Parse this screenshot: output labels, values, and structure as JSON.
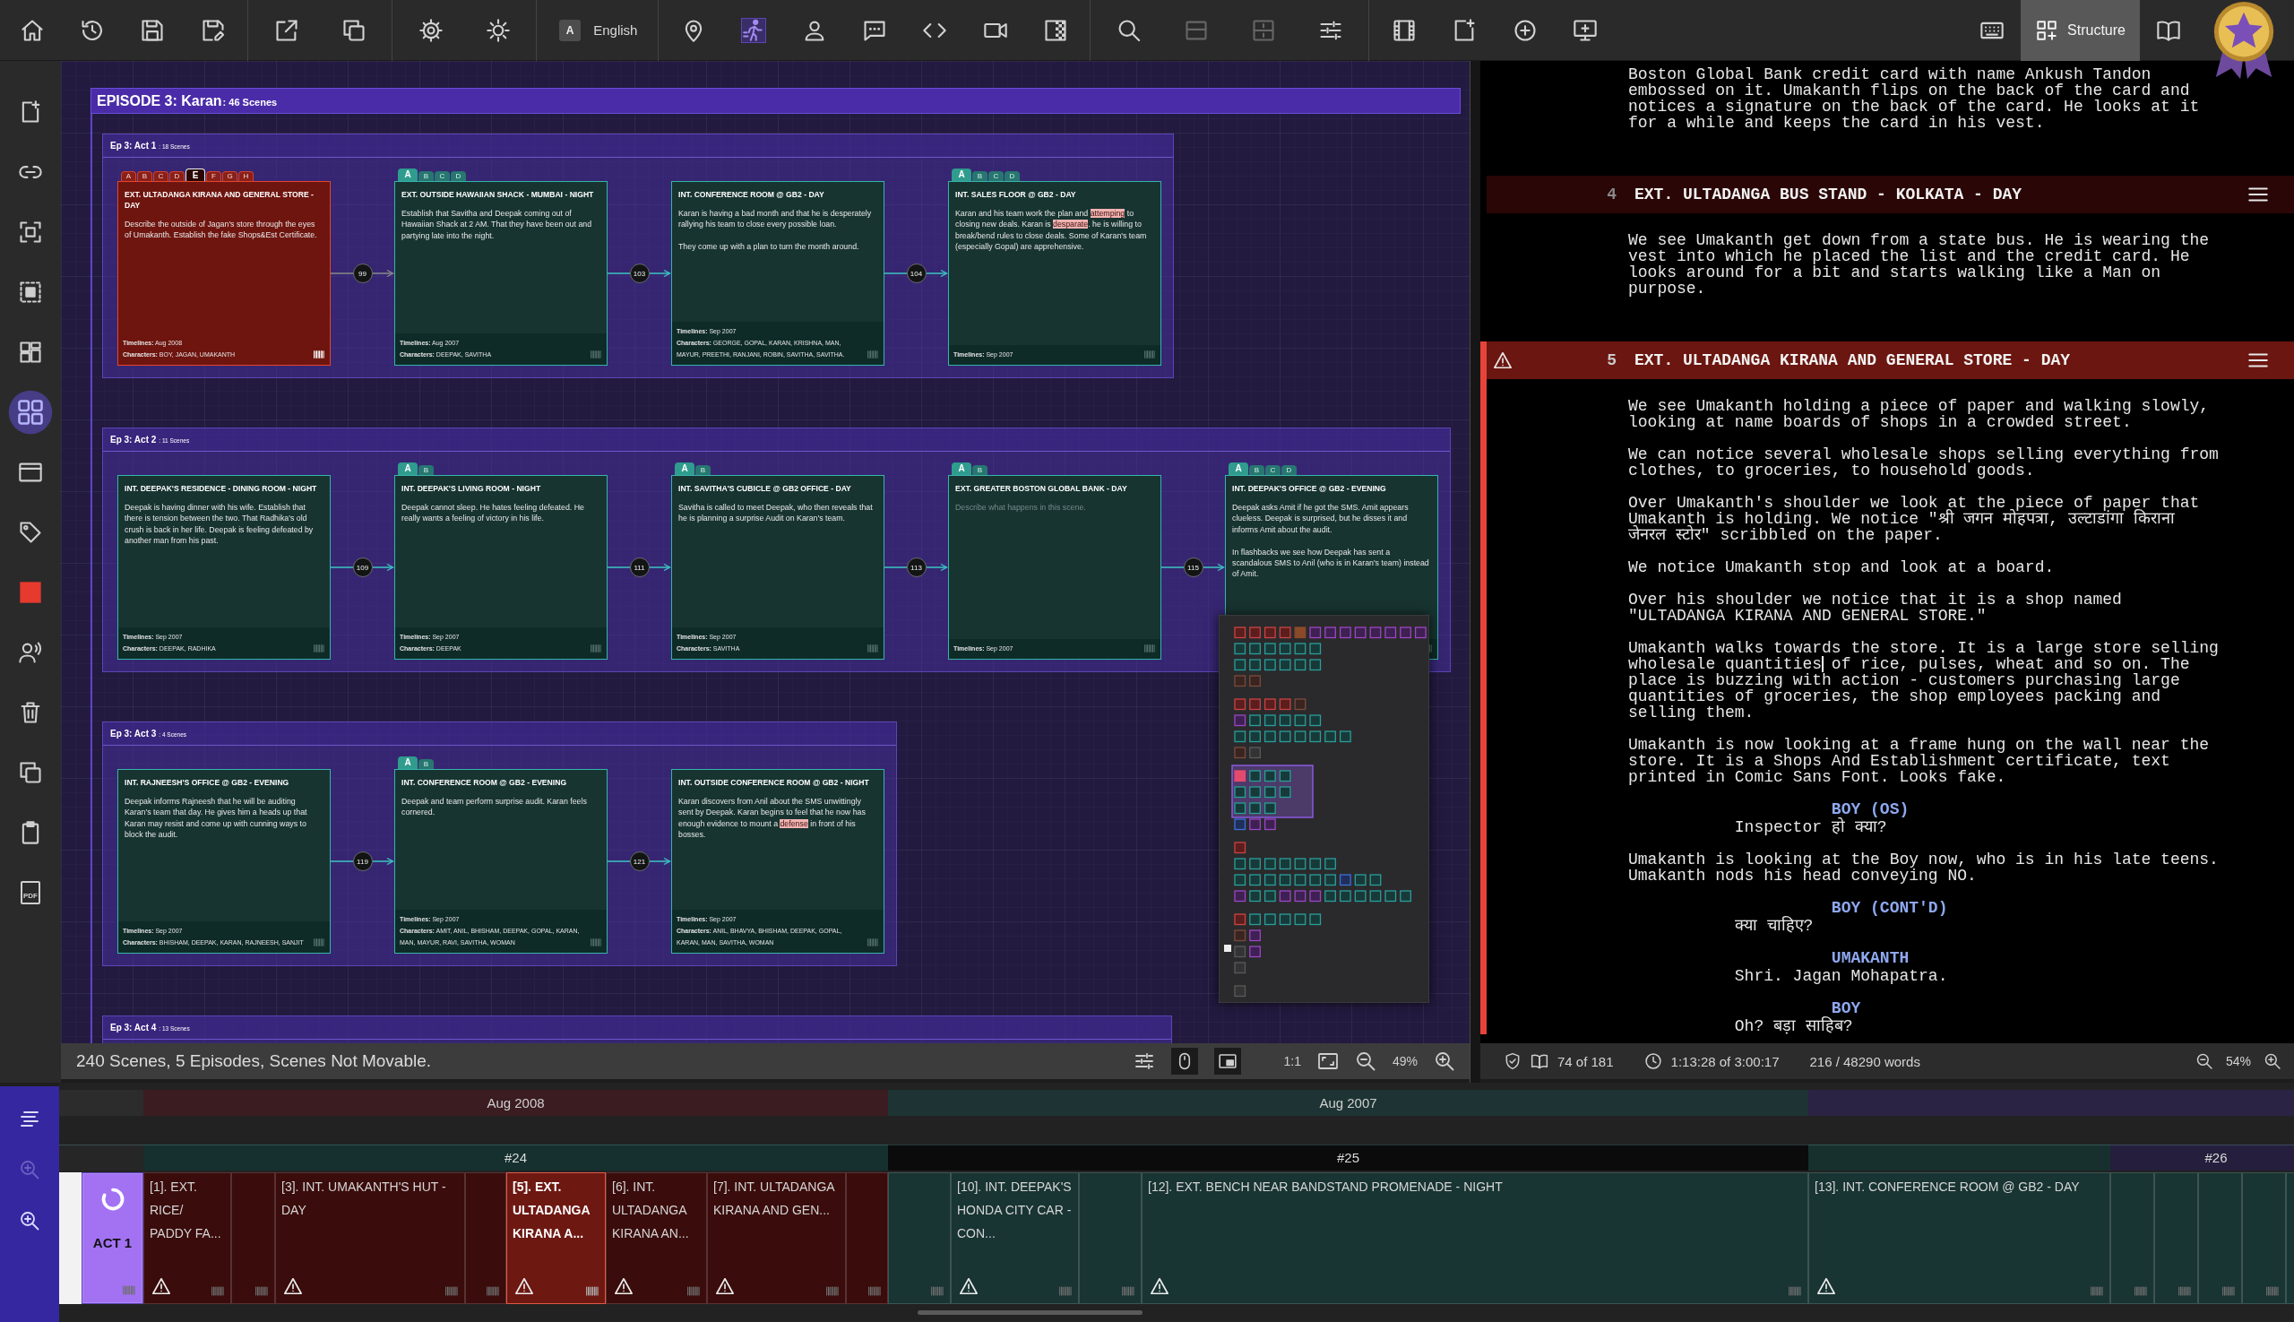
{
  "toolbar": {
    "tools": [
      {
        "active": false,
        "disabled": false
      },
      {
        "active": false,
        "disabled": false
      },
      {
        "active": false,
        "disabled": false
      },
      {
        "active": false,
        "disabled": false
      },
      {
        "active": false,
        "disabled": false
      },
      {
        "active": false,
        "disabled": false
      },
      {
        "active": false,
        "disabled": false
      },
      {
        "active": false,
        "disabled": false
      },
      {
        "active": false,
        "disabled": false
      },
      {
        "active": true,
        "disabled": false
      },
      {
        "active": false,
        "disabled": false
      },
      {
        "active": false,
        "disabled": false
      },
      {
        "active": false,
        "disabled": false
      },
      {
        "active": false,
        "disabled": false
      },
      {
        "active": false,
        "disabled": false
      },
      {
        "active": false,
        "disabled": false
      },
      {
        "active": false,
        "disabled": true
      },
      {
        "active": false,
        "disabled": true
      },
      {
        "active": false,
        "disabled": false
      },
      {
        "active": false,
        "disabled": false
      },
      {
        "active": false,
        "disabled": false
      },
      {
        "active": false,
        "disabled": false
      },
      {
        "active": false,
        "disabled": false
      },
      {
        "active": false,
        "disabled": false
      },
      {
        "active": false,
        "disabled": false
      }
    ],
    "language": {
      "badge": "A",
      "label": "English"
    },
    "structure_button": {
      "label": "Structure",
      "selected": true
    }
  },
  "sidebar": {
    "items": [
      {
        "selected": false
      },
      {
        "selected": false
      },
      {
        "selected": false
      },
      {
        "selected": false
      },
      {
        "selected": false
      },
      {
        "selected": true
      },
      {
        "selected": false
      },
      {
        "selected": false
      },
      {
        "selected": false
      },
      {
        "selected": false
      },
      {
        "selected": false
      },
      {
        "selected": false
      },
      {
        "selected": false
      },
      {
        "selected": false,
        "label": "PDF"
      }
    ]
  },
  "episode": {
    "title": "EPISODE 3: Karan",
    "scene_count": ": 46 Scenes",
    "acts": [
      {
        "title": "Ep 3: Act 1",
        "scene_count": ": 18 Scenes",
        "connectors": [
          "99",
          "103",
          "104"
        ],
        "cards": [
          {
            "selected": true,
            "tabs": [
              {
                "label": "A",
                "selected": false
              },
              {
                "label": "B",
                "selected": false
              },
              {
                "label": "C",
                "selected": false
              },
              {
                "label": "D",
                "selected": false
              },
              {
                "label": "E",
                "selected": true
              },
              {
                "label": "F",
                "selected": false
              },
              {
                "label": "G",
                "selected": false
              },
              {
                "label": "H",
                "selected": false
              }
            ],
            "title": "EXT. ULTADANGA KIRANA AND GENERAL STORE - DAY",
            "paragraphs": [
              [
                {
                  "text": "Describe the outside of Jagan's store through the eyes of Umakanth. Establish the fake Shops&Est Certificate.",
                  "flagged": false
                }
              ]
            ],
            "timelines": "**Timelines:** Aug 2008",
            "characters": "**Characters:** BOY, JAGAN, UMAKANTH"
          },
          {
            "selected": false,
            "tabs": [
              {
                "label": "A",
                "selected": true
              },
              {
                "label": "B",
                "selected": false
              },
              {
                "label": "C",
                "selected": false
              },
              {
                "label": "D",
                "selected": false
              }
            ],
            "title": "EXT. OUTSIDE HAWAIIAN SHACK - MUMBAI - NIGHT",
            "paragraphs": [
              [
                {
                  "text": "Establish that Savitha and Deepak coming out of Hawaiian Shack at 2 AM. That they have been out and partying late into the night.",
                  "flagged": false
                }
              ]
            ],
            "timelines": "**Timelines:** Aug 2007",
            "characters": "**Characters:** DEEPAK, SAVITHA"
          },
          {
            "selected": false,
            "title": "INT. CONFERENCE ROOM @ GB2 - DAY",
            "paragraphs": [
              [
                {
                  "text": "Karan is having a bad month and that he is desperately rallying his team to close every possible loan.",
                  "flagged": false
                }
              ],
              [
                {
                  "text": "They come up with a plan to turn the month around.",
                  "flagged": false
                }
              ]
            ],
            "timelines": "**Timelines:** Sep 2007",
            "characters": "**Characters:** GEORGE, GOPAL, KARAN, KRISHNA, MAN, MAYUR, PREETHI, RANJANI, ROBIN, SAVITHA, SAVITHA."
          },
          {
            "selected": false,
            "tabs": [
              {
                "label": "A",
                "selected": true
              },
              {
                "label": "B",
                "selected": false
              },
              {
                "label": "C",
                "selected": false
              },
              {
                "label": "D",
                "selected": false
              }
            ],
            "title": "INT. SALES FLOOR @ GB2 - DAY",
            "paragraphs": [
              [
                {
                  "text": "Karan and his team work the plan and ",
                  "flagged": false
                },
                {
                  "text": "attemping",
                  "flagged": true
                },
                {
                  "text": " to closing new deals. Karan is ",
                  "flagged": false
                },
                {
                  "text": "desparate",
                  "flagged": true
                },
                {
                  "text": ". he is willing to break/bend rules to close deals. Some of Karan's team (especially Gopal) are apprehensive.",
                  "flagged": false
                }
              ]
            ],
            "timelines": "**Timelines:** Sep 2007"
          }
        ]
      },
      {
        "title": "Ep 3: Act 2",
        "scene_count": ": 11 Scenes",
        "connectors": [
          "109",
          "111",
          "113",
          "115"
        ],
        "cards": [
          {
            "selected": false,
            "title": "INT. DEEPAK'S RESIDENCE - DINING ROOM - NIGHT",
            "paragraphs": [
              [
                {
                  "text": "Deepak is having dinner with his wife. Establish that there is tension between the two. That Radhika's old crush is back in her life. Deepak is feeling defeated by another man from his past.",
                  "flagged": false
                }
              ]
            ],
            "timelines": "**Timelines:** Sep 2007",
            "characters": "**Characters:** DEEPAK, RADHIKA"
          },
          {
            "selected": false,
            "tabs": [
              {
                "label": "A",
                "selected": true
              },
              {
                "label": "B",
                "selected": false
              }
            ],
            "title": "INT. DEEPAK'S LIVING ROOM - NIGHT",
            "paragraphs": [
              [
                {
                  "text": "Deepak cannot sleep. He hates feeling defeated. He really wants a feeling of victory in his life.",
                  "flagged": false
                }
              ]
            ],
            "timelines": "**Timelines:** Sep 2007",
            "characters": "**Characters:** DEEPAK"
          },
          {
            "selected": false,
            "tabs": [
              {
                "label": "A",
                "selected": true
              },
              {
                "label": "B",
                "selected": false
              }
            ],
            "title": "INT. SAVITHA'S CUBICLE @ GB2 OFFICE - DAY",
            "paragraphs": [
              [
                {
                  "text": "Savitha is called to meet Deepak, who then reveals that he is planning a surprise Audit on Karan's team.",
                  "flagged": false
                }
              ]
            ],
            "timelines": "**Timelines:** Sep 2007",
            "characters": "**Characters:** SAVITHA"
          },
          {
            "selected": false,
            "tabs": [
              {
                "label": "A",
                "selected": true
              },
              {
                "label": "B",
                "selected": false
              }
            ],
            "title": "EXT. GREATER BOSTON GLOBAL BANK - DAY",
            "placeholder": "Describe what happens in this scene.",
            "timelines": "**Timelines:** Sep 2007"
          },
          {
            "selected": false,
            "tabs": [
              {
                "label": "A",
                "selected": true
              },
              {
                "label": "B",
                "selected": false
              },
              {
                "label": "C",
                "selected": false
              },
              {
                "label": "D",
                "selected": false
              }
            ],
            "title": "INT. DEEPAK'S OFFICE @ GB2 - EVENING",
            "paragraphs": [
              [
                {
                  "text": "Deepak asks Amit if he got the SMS. Amit appears clueless. Deepak is surprised, but he disses it and informs Amit about the audit.",
                  "flagged": false
                }
              ],
              [
                {
                  "text": "In flashbacks we see how Deepak has sent a scandalous SMS to Anil (who is in Karan's team) instead of Amit.",
                  "flagged": false
                }
              ]
            ]
          }
        ]
      },
      {
        "title": "Ep 3: Act 3",
        "scene_count": ": 4 Scenes",
        "connectors": [
          "119",
          "121"
        ],
        "cards": [
          {
            "selected": false,
            "title": "INT. RAJNEESH'S OFFICE @ GB2 - EVENING",
            "paragraphs": [
              [
                {
                  "text": "Deepak informs Rajneesh that he will be auditing Karan's team that day. He gives him a heads up that Karan may resist and come up with cunning ways to block the audit.",
                  "flagged": false
                }
              ]
            ],
            "timelines": "**Timelines:** Sep 2007",
            "characters": "**Characters:** BHISHAM, DEEPAK, KARAN, RAJNEESH, SANJIT"
          },
          {
            "selected": false,
            "tabs": [
              {
                "label": "A",
                "selected": true
              },
              {
                "label": "B",
                "selected": false
              }
            ],
            "title": "INT. CONFERENCE ROOM @ GB2 - EVENING",
            "paragraphs": [
              [
                {
                  "text": "Deepak and team perform surprise audit. Karan feels cornered.",
                  "flagged": false
                }
              ]
            ],
            "timelines": "**Timelines:** Sep 2007",
            "characters": "**Characters:** AMIT, ANIL, BHISHAM, DEEPAK, GOPAL, KARAN, MAN, MAYUR, RAVI, SAVITHA, WOMAN"
          },
          {
            "selected": false,
            "title": "INT. OUTSIDE CONFERENCE ROOM @ GB2 - NIGHT",
            "paragraphs": [
              [
                {
                  "text": "Karan discovers from Anil about the SMS unwittingly sent by Deepak. Karan begins to feel that he now has enough evidence to mount a ",
                  "flagged": false
                },
                {
                  "text": "defense",
                  "flagged": true
                },
                {
                  "text": " in front of his bosses.",
                  "flagged": false
                }
              ]
            ],
            "timelines": "**Timelines:** Sep 2007",
            "characters": "**Characters:** ANIL, BHAVYA, BHISHAM, DEEPAK, GOPAL, KARAN, MAN, SAVITHA, WOMAN"
          }
        ]
      },
      {
        "title": "Ep 3: Act 4",
        "scene_count": ": 13 Scenes"
      }
    ]
  },
  "structure_status": {
    "text": "240 Scenes, 5 Episodes, Scenes Not Movable.",
    "toggles": [
      {
        "on": false
      },
      {
        "on": true
      },
      {
        "on": true
      }
    ],
    "actual_size": "1:1",
    "zoom": "49%"
  },
  "script": {
    "scenes": [
      {
        "selected": false,
        "blocks": [
          {
            "kind": "action",
            "text": "Boston Global Bank credit card with name Ankush Tandon embossed on it. Umakanth flips on the back of the card and notices a signature on the back of the card. He looks at it for a while and keeps the card in his vest."
          }
        ]
      },
      {
        "selected": false,
        "heading": {
          "number": "4",
          "text": "EXT. ULTADANGA BUS STAND - KOLKATA - DAY",
          "warning": false
        },
        "blocks": [
          {
            "kind": "action",
            "text": "We see Umakanth get down from a state bus. He is wearing the vest into which he placed the list and the credit card. He looks around for a bit and starts walking like a Man on purpose."
          }
        ]
      },
      {
        "selected": true,
        "heading": {
          "number": "5",
          "text": "EXT. ULTADANGA KIRANA AND GENERAL STORE - DAY",
          "warning": true
        },
        "blocks": [
          {
            "kind": "action",
            "text": "We see Umakanth holding a piece of paper and walking slowly, looking at name boards of shops in a crowded street."
          },
          {
            "kind": "action",
            "text": "We can notice several wholesale shops selling everything from clothes, to groceries, to household goods."
          },
          {
            "kind": "action",
            "text": "Over Umakanth's shoulder we look at the piece of paper that Umakanth is holding. We notice \"श्री जगन मोहपत्रा, उल्टाडांगा किराना जेनरल स्टोर\" scribbled on the paper."
          },
          {
            "kind": "action",
            "text": "We notice Umakanth stop and look at a board."
          },
          {
            "kind": "action",
            "text": "Over his shoulder we notice that it is a shop named \"ULTADANGA KIRANA AND GENERAL STORE.\""
          },
          {
            "kind": "action",
            "runs": [
              {
                "text": "Umakanth walks towards the store. It is a large store selling wholesale quantities",
                "cursor": true
              },
              {
                "text": " of rice, pulses, wheat and so on. The place is buzzing with action - customers purchasing large quantities of groceries, the shop employees packing and selling them.",
                "cursor": false
              }
            ]
          },
          {
            "kind": "action",
            "text": "Umakanth is now looking at a frame hung on the wall near the store. It is a Shops And Establishment certificate, text printed in Comic Sans Font. Looks fake."
          },
          {
            "kind": "character",
            "text": "BOY (OS)"
          },
          {
            "kind": "dialogue",
            "text": "Inspector हो क्या?"
          },
          {
            "kind": "action",
            "text": "Umakanth is looking at the Boy now, who is in his late teens. Umakanth nods his head conveying NO."
          },
          {
            "kind": "character",
            "text": "BOY (CONT'D)"
          },
          {
            "kind": "dialogue",
            "text": "क्या चाहिए?"
          },
          {
            "kind": "character",
            "text": "UMAKANTH"
          },
          {
            "kind": "dialogue",
            "text": "Shri. Jagan Mohapatra."
          },
          {
            "kind": "character",
            "text": "BOY"
          },
          {
            "kind": "dialogue",
            "text": "Oh? बड़ा साहिब?"
          }
        ]
      }
    ]
  },
  "script_status": {
    "page": "74 of 181",
    "time": "1:13:28 of 3:00:17",
    "words": "216 / 48290 words",
    "zoom": "54%"
  },
  "timeline": {
    "tools": [
      {
        "disabled": false
      },
      {
        "disabled": true
      },
      {
        "disabled": false
      }
    ],
    "groups": [
      {
        "color": "#2c2c2c",
        "sequences": [
          {
            "color": "#262626",
            "blocks": [
              {
                "kind": "cut",
                "color": "#f2f2f2",
                "selected": false
              },
              {
                "kind": "act",
                "label": "ACT 1",
                "color": "#a372f3",
                "selected": false,
                "warning": false
              }
            ]
          }
        ]
      },
      {
        "label": "Aug 2008",
        "color": "#3b1c21",
        "sequences": [
          {
            "label": "#24",
            "color": "#15302e",
            "blocks": [
              {
                "kind": "scene",
                "label": "[1]. EXT. RICE/ PADDY FA...",
                "color": "#3a0c0c",
                "selected": false,
                "warning": true
              },
              {
                "kind": "scene",
                "color": "#3a0c0c",
                "selected": false,
                "warning": false
              },
              {
                "kind": "scene",
                "label": "[3]. INT. UMAKANTH'S HUT - DAY",
                "color": "#3a0c0c",
                "selected": false,
                "warning": true
              },
              {
                "kind": "scene",
                "color": "#3a0c0c",
                "selected": false,
                "warning": false
              },
              {
                "kind": "scene",
                "label": "[5]. EXT. ULTADANGA KIRANA A...",
                "color": "#6e1812",
                "selected": true,
                "warning": true
              },
              {
                "kind": "scene",
                "label": "[6]. INT. ULTADANGA KIRANA AN...",
                "color": "#3a0c0c",
                "selected": false,
                "warning": true
              },
              {
                "kind": "scene",
                "label": "[7]. INT. ULTADANGA KIRANA AND GEN...",
                "color": "#3a0c0c",
                "selected": false,
                "warning": true
              },
              {
                "kind": "scene",
                "color": "#3a0c0c",
                "selected": false,
                "warning": false
              }
            ]
          }
        ]
      },
      {
        "label": "Aug 2007",
        "color": "#1e3434",
        "sequences": [
          {
            "label": "#25",
            "color": "#0b0b0b",
            "blocks": [
              {
                "kind": "scene",
                "color": "#183433",
                "selected": false,
                "warning": false
              },
              {
                "kind": "scene",
                "label": "[10]. INT. DEEPAK'S HONDA CITY CAR - CON...",
                "color": "#183433",
                "selected": false,
                "warning": true
              },
              {
                "kind": "scene",
                "color": "#183433",
                "selected": false,
                "warning": false
              },
              {
                "kind": "scene",
                "label": "[12]. EXT. BENCH NEAR BANDSTAND PROMENADE - NIGHT",
                "color": "#183433",
                "selected": false,
                "warning": true
              }
            ]
          }
        ]
      },
      {
        "color": "#2b2343",
        "sequences": [
          {
            "color": "#17302e",
            "blocks": [
              {
                "kind": "scene",
                "label": "[13]. INT. CONFERENCE ROOM @ GB2 - DAY",
                "color": "#183433",
                "selected": false,
                "warning": true
              }
            ]
          },
          {
            "label": "#26",
            "color": "#251f3d",
            "blocks": [
              {
                "kind": "scene",
                "color": "#183433",
                "selected": false,
                "warning": false
              },
              {
                "kind": "scene",
                "color": "#183433",
                "selected": false,
                "warning": false
              },
              {
                "kind": "scene",
                "color": "#183433",
                "selected": false,
                "warning": false
              },
              {
                "kind": "scene",
                "color": "#183433",
                "selected": false,
                "warning": false
              },
              {
                "kind": "cut",
                "color": "#183433",
                "selected": false
              }
            ]
          }
        ]
      }
    ]
  }
}
